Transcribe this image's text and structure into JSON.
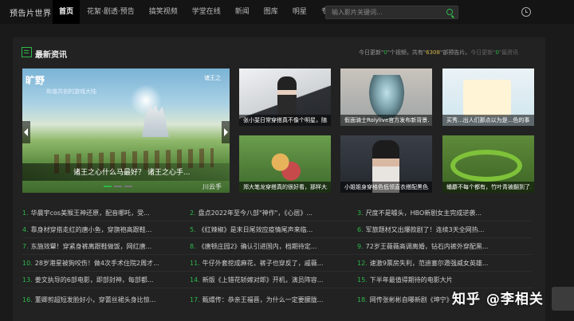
{
  "header": {
    "logo": "预告片世界",
    "nav": [
      {
        "label": "首页",
        "active": true
      },
      {
        "label": "花絮·剧透·预告",
        "active": false
      },
      {
        "label": "搞笑视频",
        "active": false
      },
      {
        "label": "学堂在线",
        "active": false
      },
      {
        "label": "新闻",
        "active": false
      },
      {
        "label": "图库",
        "active": false
      },
      {
        "label": "明星",
        "active": false
      },
      {
        "label": "专题",
        "active": false
      }
    ],
    "search_placeholder": "输入影片关键词...",
    "icons": {
      "search": "search-icon",
      "history": "clock-icon"
    }
  },
  "section": {
    "title": "最新资讯",
    "stats": {
      "prefix": "今日更新\"",
      "today_videos": "0",
      "mid": "\"个视频，共有\"",
      "total_trailers": "6308",
      "suffix": "\"部预告片。",
      "today2_prefix": "今日更新\"",
      "today2_count": "0",
      "today2_suffix": "\"篇资讯"
    }
  },
  "hero": {
    "logo": "旷野",
    "subtitle": "和谐共创的游戏大陆",
    "tag": "诸王之",
    "caption": "诸王之心什么马最好？ 诸王之心手...",
    "caption2": "川云手"
  },
  "thumbs": [
    {
      "caption": "张小斐日常穿搭真不像个明星，随..."
    },
    {
      "caption": "假面骑士Rolylive官方发布新背景..."
    },
    {
      "caption": "买秀...出人们那点以为是...色的事"
    },
    {
      "caption": "郑大笔龙穿搭真的很好看，那样大..."
    },
    {
      "caption": "小姐姐身穿格色低领直衣搭配黑色..."
    },
    {
      "caption": "蟠麝不每个都有，竹叶青被翻到了..."
    }
  ],
  "news": [
    [
      "1.",
      "华晨宇cos美猴王神还原，配音哪吒，受...",
      "2.",
      "盘点2022年至今八部\"神作\"，《心居》...",
      "3.",
      "尺度不是噱头，HBO新剧女主完成逆袭..."
    ],
    [
      "4.",
      "靠身材穿搭走红的唐小鱼，穿旗袍高跟鞋...",
      "5.",
      "《红辣椒》是末日尾效应疫情尾声来临...",
      "6.",
      "军旅题材又出爆款剧了！连续3天全网热..."
    ],
    [
      "7.",
      "东施效颦！穿紧身裤离跟鞋做饭，网红唐...",
      "8.",
      "《唐顿庄园2》确认引进国内，档期待定...",
      "9.",
      "72岁王薇薇高调离婚，钻石内裤外穿配黑..."
    ],
    [
      "10.",
      "28岁港星被狗咬伤！做4次手术住院2周才...",
      "11.",
      "牛仔外套挖成麻花，裤子也穿反了，戚薇...",
      "12.",
      "速激9票房失利，范迪塞尔邀强威女英雄..."
    ],
    [
      "13.",
      "姜文执导的6部电影，即部封神，每部都...",
      "14.",
      "新版《上错花轿嫁对郎》开机，演员阵容...",
      "15.",
      "下半年最值得期待的电影大片"
    ],
    [
      "16.",
      "董卿剪超短发脸好小，穿蕾丝裙头身比惊...",
      "17.",
      "甄嬛传：恭亲王福晋，为什么一定要朦胧...",
      "18.",
      "网传张彬彬自曝新剧《坤宁》..."
    ]
  ],
  "watermark": "知乎 @李相关",
  "colors": {
    "accent": "#2db84a",
    "highlight": "#d4b64a",
    "bg": "#1a1a1a"
  }
}
